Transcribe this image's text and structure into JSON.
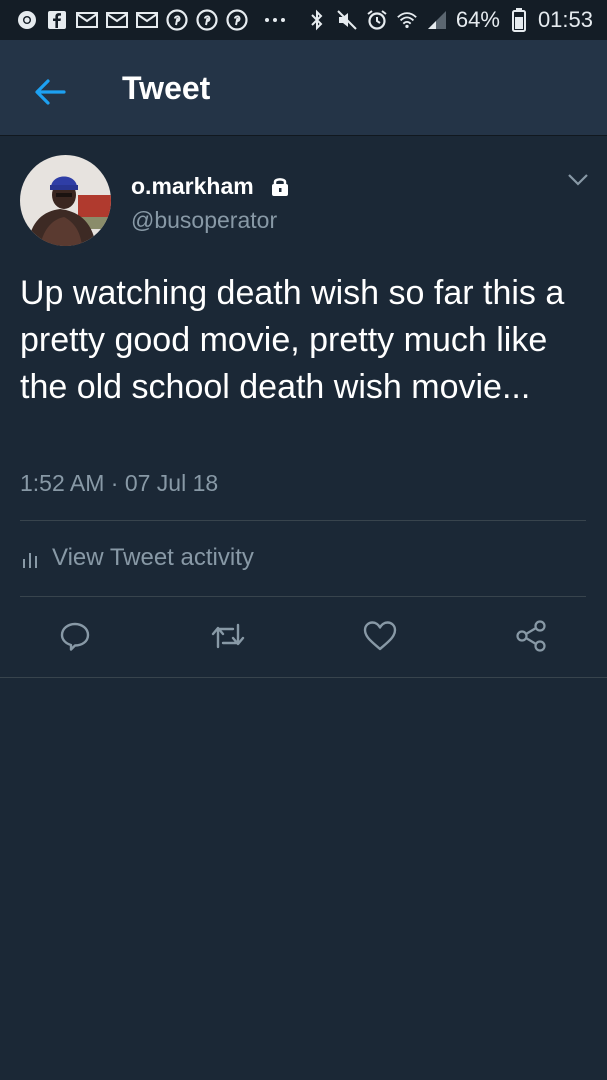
{
  "status_bar": {
    "battery_percent": "64%",
    "time": "01:53",
    "notification_icons": [
      "chrome-icon",
      "facebook-icon",
      "mail-icon",
      "mail-icon",
      "mail-icon",
      "pinterest-icon",
      "pinterest-icon",
      "pinterest-icon",
      "more-dots-icon"
    ],
    "system_icons": [
      "bluetooth-icon",
      "mute-icon",
      "alarm-icon",
      "wifi-icon",
      "signal-icon",
      "battery-icon"
    ]
  },
  "header": {
    "title": "Tweet"
  },
  "tweet": {
    "display_name": "o.markham",
    "handle": "@busoperator",
    "text": "Up watching death wish so far this a pretty good movie, pretty much like the old school death wish movie...",
    "timestamp": "1:52 AM · 07 Jul 18",
    "activity_label": "View Tweet activity",
    "protected": true
  },
  "colors": {
    "background": "#1b2836",
    "header_background": "#243447",
    "status_bar_background": "#141d26",
    "accent": "#1da1f2",
    "secondary_text": "#8899a6",
    "divider": "#38444d"
  },
  "actions": [
    "reply-icon",
    "retweet-icon",
    "like-icon",
    "share-icon"
  ]
}
